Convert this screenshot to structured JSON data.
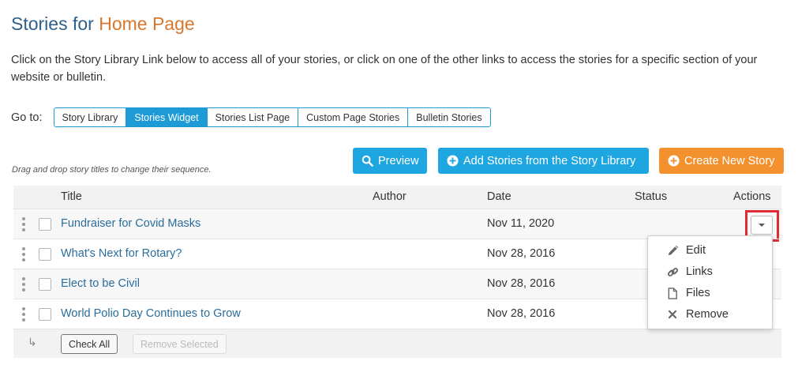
{
  "header": {
    "title_prefix": "Stories for ",
    "title_accent": "Home Page",
    "intro": "Click on the Story Library Link below to access all of your stories, or click on one of the other links to access the stories for a specific section of your website or bulletin."
  },
  "goto": {
    "label": "Go to:",
    "tabs": [
      {
        "label": "Story Library",
        "active": false
      },
      {
        "label": "Stories Widget",
        "active": true
      },
      {
        "label": "Stories List Page",
        "active": false
      },
      {
        "label": "Custom Page Stories",
        "active": false
      },
      {
        "label": "Bulletin Stories",
        "active": false
      }
    ]
  },
  "toolbar": {
    "drag_hint": "Drag and drop story titles to change their sequence.",
    "preview_label": "Preview",
    "add_label": "Add Stories from the Story Library",
    "create_label": "Create New Story"
  },
  "table": {
    "columns": {
      "title": "Title",
      "author": "Author",
      "date": "Date",
      "status": "Status",
      "actions": "Actions"
    },
    "rows": [
      {
        "title": "Fundraiser for Covid Masks",
        "author": "",
        "date": "Nov 11, 2020",
        "status": ""
      },
      {
        "title": "What's Next for Rotary?",
        "author": "",
        "date": "Nov 28, 2016",
        "status": ""
      },
      {
        "title": "Elect to be Civil",
        "author": "",
        "date": "Nov 28, 2016",
        "status": ""
      },
      {
        "title": "World Polio Day Continues to Grow",
        "author": "",
        "date": "Nov 28, 2016",
        "status": ""
      }
    ],
    "check_all_label": "Check All",
    "remove_selected_label": "Remove Selected"
  },
  "actions_menu": {
    "items": [
      {
        "label": "Edit",
        "icon": "pencil-icon"
      },
      {
        "label": "Links",
        "icon": "link-icon"
      },
      {
        "label": "Files",
        "icon": "file-icon"
      },
      {
        "label": "Remove",
        "icon": "close-icon"
      }
    ]
  },
  "colors": {
    "title_blue": "#2d5f8a",
    "title_orange": "#d9772d",
    "primary_blue": "#1ea6e0",
    "accent_orange": "#f3912f",
    "link_blue": "#2a6d9c",
    "highlight_red": "#e02b35"
  }
}
